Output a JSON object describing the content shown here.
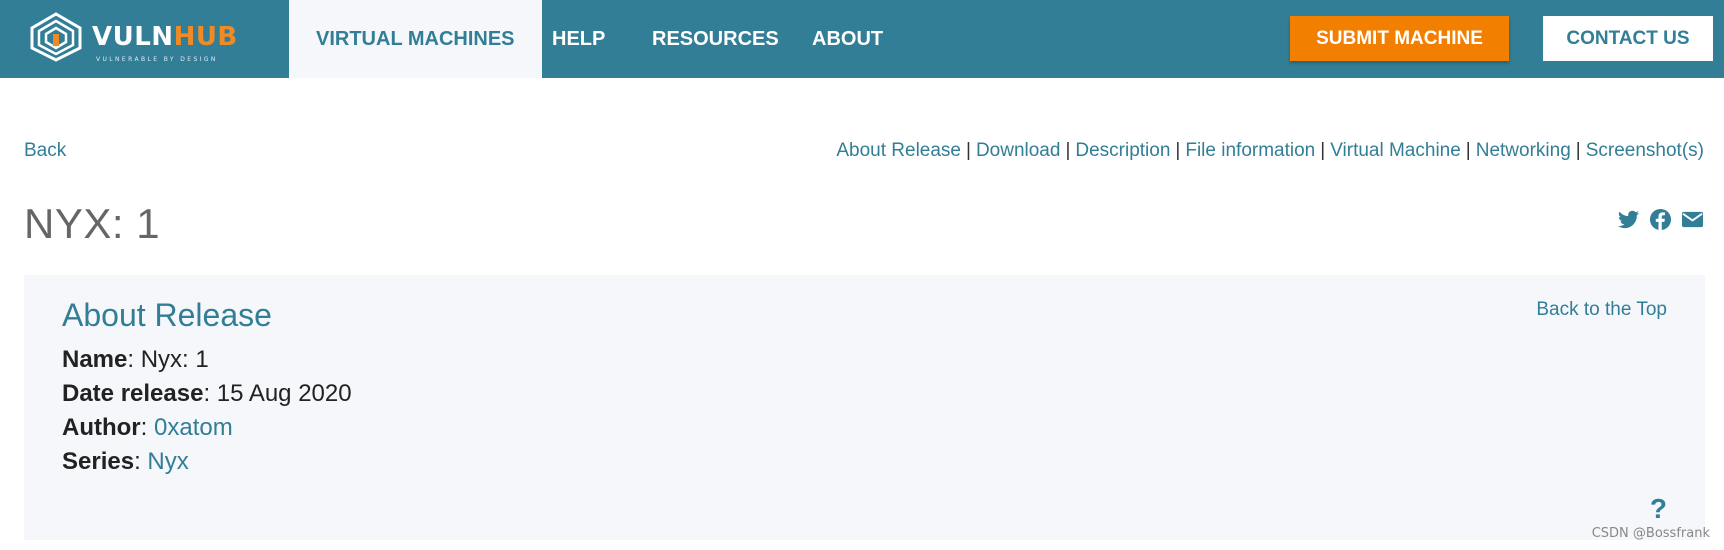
{
  "logo": {
    "brand_main": "VULN",
    "brand_accent": "HUB",
    "tagline": "VULNERABLE BY DESIGN"
  },
  "nav": {
    "items": [
      "VIRTUAL MACHINES",
      "HELP",
      "RESOURCES",
      "ABOUT"
    ],
    "submit": "SUBMIT MACHINE",
    "contact": "CONTACT US"
  },
  "subnav": {
    "back": "Back",
    "anchors": [
      "About Release",
      "Download",
      "Description",
      "File information",
      "Virtual Machine",
      "Networking",
      "Screenshot(s)"
    ],
    "separator": "|"
  },
  "title": "NYX: 1",
  "share_icons": [
    "twitter-icon",
    "facebook-icon",
    "email-icon"
  ],
  "panel": {
    "heading": "About Release",
    "back_to_top": "Back to the Top",
    "name_label": "Name",
    "name_value": "Nyx: 1",
    "date_label": "Date release",
    "date_value": "15 Aug 2020",
    "author_label": "Author",
    "author_value": "0xatom",
    "series_label": "Series",
    "series_value": "Nyx",
    "help": "?"
  },
  "watermark": "CSDN @Bossfrank",
  "colors": {
    "primary": "#327e97",
    "accent": "#f37f00",
    "panel_bg": "#f5f7fb"
  }
}
